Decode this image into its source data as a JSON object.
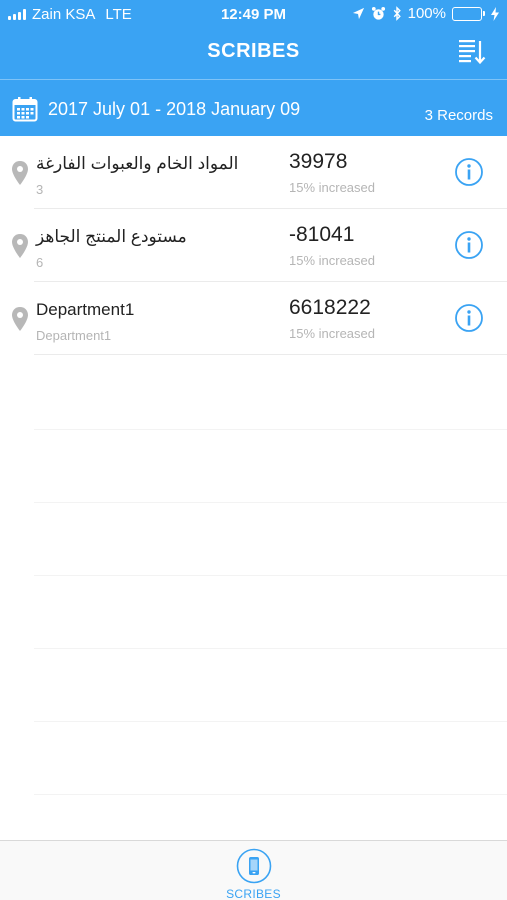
{
  "status_bar": {
    "carrier": "Zain KSA",
    "network": "LTE",
    "time": "12:49 PM",
    "battery_percent": "100%",
    "icons": [
      "location-arrow-icon",
      "alarm-clock-icon",
      "bluetooth-icon",
      "battery-icon",
      "charging-bolt-icon"
    ]
  },
  "nav": {
    "title": "SCRIBES",
    "sort_icon": "sort-list-icon"
  },
  "filter": {
    "date_range": "2017 July 01 - 2018 January 09",
    "records": "3 Records",
    "icon": "calendar-icon"
  },
  "items": [
    {
      "name": "المواد الخام والعبوات الفارغة",
      "sub": "3",
      "value": "39978",
      "change": "15% increased"
    },
    {
      "name": "مستودع المنتج الجاهز",
      "sub": "6",
      "value": "-81041",
      "change": "15% increased"
    },
    {
      "name": "Department1",
      "sub": "Department1",
      "value": "6618222",
      "change": "15% increased"
    }
  ],
  "tab_bar": {
    "tabs": [
      {
        "label": "SCRIBES",
        "icon": "phone-device-icon",
        "active": true
      }
    ]
  },
  "colors": {
    "primary": "#3aa3f3",
    "text": "#222222",
    "muted": "#b5b5b5",
    "pin": "#b8b8b8",
    "battery_fill": "#4cd964"
  }
}
